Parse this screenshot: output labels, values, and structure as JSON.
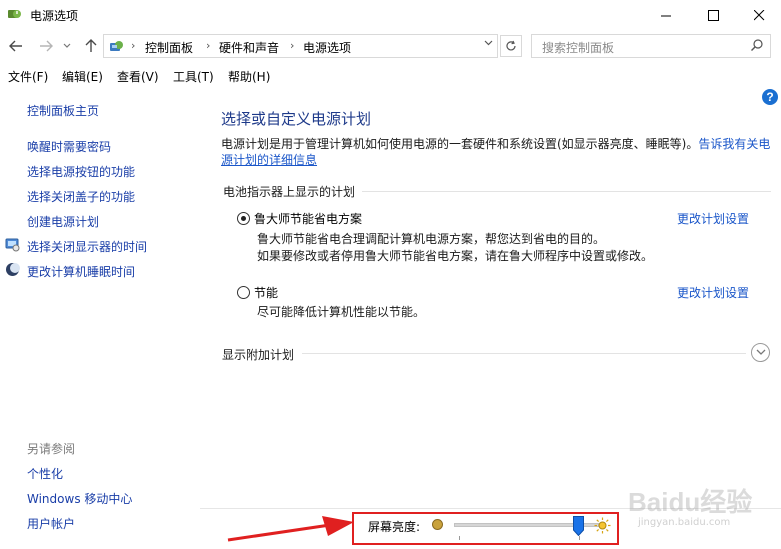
{
  "window": {
    "title": "电源选项"
  },
  "breadcrumbs": [
    "控制面板",
    "硬件和声音",
    "电源选项"
  ],
  "search": {
    "placeholder": "搜索控制面板"
  },
  "menu": [
    "文件(F)",
    "编辑(E)",
    "查看(V)",
    "工具(T)",
    "帮助(H)"
  ],
  "sidebar": {
    "home": "控制面板主页",
    "items": [
      {
        "label": "唤醒时需要密码",
        "icon": ""
      },
      {
        "label": "选择电源按钮的功能",
        "icon": ""
      },
      {
        "label": "选择关闭盖子的功能",
        "icon": ""
      },
      {
        "label": "创建电源计划",
        "icon": ""
      },
      {
        "label": "选择关闭显示器的时间",
        "icon": "monitor-icon"
      },
      {
        "label": "更改计算机睡眠时间",
        "icon": "moon-icon"
      }
    ],
    "see_also_title": "另请参阅",
    "see_also": [
      "个性化",
      "Windows 移动中心",
      "用户帐户"
    ]
  },
  "main": {
    "title": "选择或自定义电源计划",
    "description": "电源计划是用于管理计算机如何使用电源的一套硬件和系统设置(如显示器亮度、睡眠等)。",
    "description_link_part1": "告诉我有关电",
    "description_link_part2": "源计划的详细信息",
    "section_label": "电池指示器上显示的计划",
    "plans": [
      {
        "name": "鲁大师节能省电方案",
        "selected": true,
        "desc_lines": [
          "鲁大师节能省电合理调配计算机电源方案，帮您达到省电的目的。",
          "如果要修改或者停用鲁大师节能省电方案，请在鲁大师程序中设置或修改。"
        ],
        "link": "更改计划设置"
      },
      {
        "name": "节能",
        "selected": false,
        "desc_lines": [
          "尽可能降低计算机性能以节能。"
        ],
        "link": "更改计划设置"
      }
    ],
    "more_plans_label": "显示附加计划"
  },
  "brightness": {
    "label": "屏幕亮度:",
    "level_fraction": 0.86
  },
  "watermark": {
    "text": "Baidu经验",
    "sub": "jingyan.baidu.com"
  },
  "colors": {
    "accent": "#1a56c9",
    "title": "#1e3a8a",
    "annotation": "#e02020"
  }
}
